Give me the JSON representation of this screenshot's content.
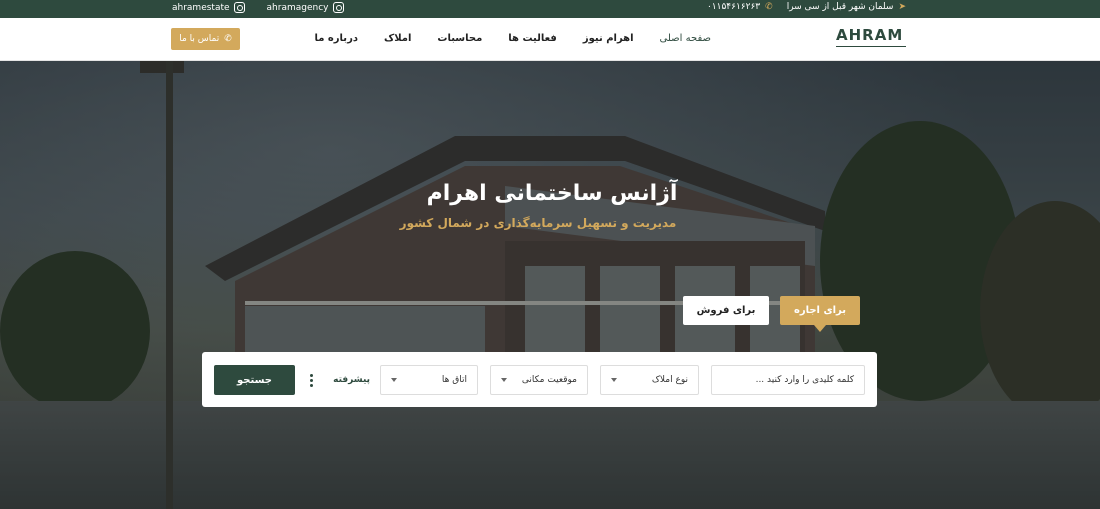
{
  "topbar": {
    "address": "سلمان شهر قبل از سی سرا",
    "phone": "۰۱۱۵۴۶۱۶۲۶۳",
    "instagram_agency": "ahramagency",
    "instagram_estate": "ahramestate",
    "icons": [
      "location-arrow-icon",
      "phone-icon",
      "instagram-icon"
    ]
  },
  "header": {
    "logo_text": "AHRAM",
    "contact_label": "تماس با ما",
    "menu": [
      {
        "label": "صفحه اصلی",
        "active": true
      },
      {
        "label": "اهرام نیوز",
        "active": false
      },
      {
        "label": "فعالیت ها",
        "active": false
      },
      {
        "label": "محاسبات",
        "active": false
      },
      {
        "label": "املاک",
        "active": false
      },
      {
        "label": "درباره ما",
        "active": false
      }
    ]
  },
  "hero": {
    "title": "آژانس ساختمانی اهرام",
    "subtitle": "مدیریت و تسهیل سرمایه‌گذاری در شمال کشور"
  },
  "tabs": {
    "rent": "برای اجاره",
    "sale": "برای فروش"
  },
  "search": {
    "keyword_placeholder": "کلمه کلیدی را وارد کنید ...",
    "type_label": "نوع املاک",
    "location_label": "موقعیت مکانی",
    "rooms_label": "اتاق ها",
    "advanced_label": "پیشرفته",
    "search_button": "جستجو"
  },
  "colors": {
    "brand_green": "#2e4a3e",
    "accent_gold": "#d3a95c"
  }
}
